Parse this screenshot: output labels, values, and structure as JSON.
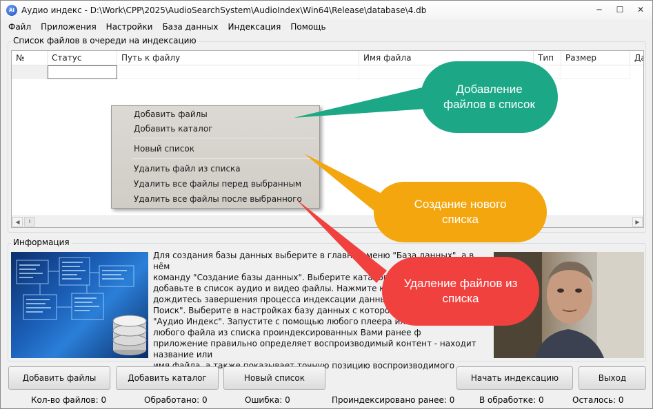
{
  "window": {
    "title": "Аудио индекс - D:\\Work\\CPP\\2025\\AudioSearchSystem\\AudioIndex\\Win64\\Release\\database\\4.db",
    "app_icon_text": "AI",
    "minimize": "─",
    "maximize": "☐",
    "close": "✕"
  },
  "menu": [
    "Файл",
    "Приложения",
    "Настройки",
    "База данных",
    "Индексация",
    "Помощь"
  ],
  "queue": {
    "group_label": "Список файлов в очереди на индексацию",
    "columns": [
      "№",
      "Статус",
      "Путь к файлу",
      "Имя файла",
      "Тип",
      "Размер",
      "Да"
    ]
  },
  "context_menu": {
    "items": [
      "Добавить файлы",
      "Добавить каталог",
      "Новый список",
      "Удалить файл из списка",
      "Удалить все файлы перед выбранным",
      "Удалить все файлы после выбранного"
    ]
  },
  "info": {
    "group_label": "Информация",
    "lines": [
      "Для создания базы данных выберите в главном меню \"База данных\", а в нём",
      "команду \"Создание базы данных\". Выберите каталог и",
      "добавьте в список аудио и видео файлы. Нажмите кнопку",
      "дождитесь завершения процесса индексации данных. Запу",
      "Поиск\". Выберите в настройках базу данных с которой Вы",
      "\"Аудио Индекс\". Запустите с помощью любого плеера или",
      "любого файла из списка проиндексированных Вами ранее ф",
      "приложение правильно определяет воспроизводимый контент - находит название или",
      "имя файла, а также показывает точную позицию воспроизводимого контента."
    ]
  },
  "buttons": {
    "add_files": "Добавить файлы",
    "add_folder": "Добавить каталог",
    "new_list": "Новый список",
    "start_indexing": "Начать индексацию",
    "exit": "Выход"
  },
  "status": {
    "file_count": "Кол-во файлов: 0",
    "processed": "Обработано: 0",
    "errors": "Ошибка: 0",
    "indexed_before": "Проиндексировано ранее: 0",
    "in_progress": "В обработке: 0",
    "remaining": "Осталось: 0"
  },
  "callouts": {
    "add": "Добавление файлов в список",
    "create": "Создание нового списка",
    "delete": "Удаление файлов из списка"
  },
  "colors": {
    "callout_add": "#1ca887",
    "callout_create": "#f4a60e",
    "callout_delete": "#f0413f"
  }
}
